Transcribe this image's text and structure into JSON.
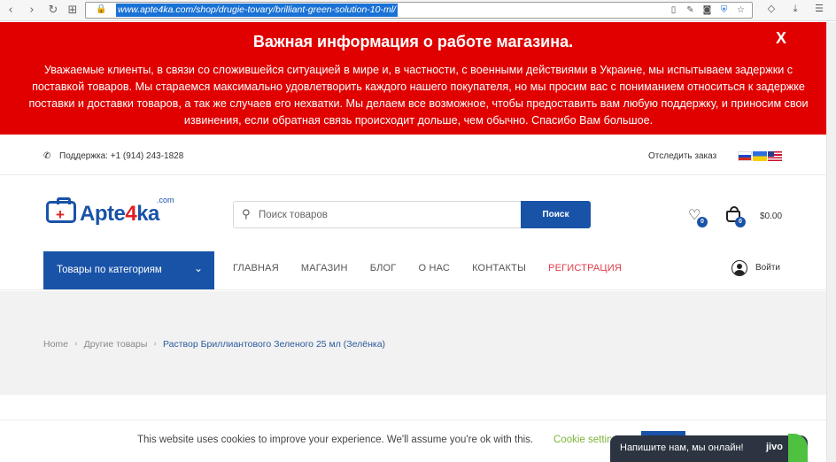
{
  "browser": {
    "url": "www.apte4ka.com/shop/drugie-tovary/brilliant-green-solution-10-ml/"
  },
  "notice": {
    "title": "Важная информация о работе магазина.",
    "close": "X",
    "body": "Уважаемые клиенты, в связи со сложившейся ситуацией в мире и, в частности, с военными действиями в Украине, мы испытываем задержки с поставкой товаров. Мы стараемся максимально удовлетворить каждого нашего покупателя, но мы просим вас с пониманием относиться к задержке поставки и доставки товаров, а так же случаев его нехватки. Мы делаем все возможное, чтобы предоставить вам любую поддержку, и приносим свои извинения, если обратная связь происходит дольше, чем обычно. Спасибо Вам большое."
  },
  "topbar": {
    "support": "Поддержка: +1 (914) 243-1828",
    "track_order": "Отследить заказ"
  },
  "header": {
    "logo_main": "Apte",
    "logo_four": "4",
    "logo_end": "ka",
    "logo_com": ".com",
    "search_placeholder": "Поиск товаров",
    "search_button": "Поиск",
    "wishlist_count": "0",
    "cart_count": "0",
    "cart_total": "$0.00"
  },
  "nav": {
    "categories": "Товары по категориям",
    "items": [
      "ГЛАВНАЯ",
      "МАГАЗИН",
      "БЛОГ",
      "О НАС",
      "КОНТАКТЫ",
      "РЕГИСТРАЦИЯ"
    ],
    "login": "Войти"
  },
  "breadcrumb": {
    "items": [
      "Home",
      "Другие товары",
      "Раствор Бриллиантового Зеленого 25 мл (Зелёнка)"
    ]
  },
  "cookie": {
    "text": "This website uses cookies to improve your experience. We'll assume you're ok with this.",
    "settings": "Cookie settings"
  },
  "chat": {
    "text": "Напишите нам, мы онлайн!",
    "brand": "jivo"
  },
  "colors": {
    "brand_blue": "#1953a8",
    "notice_red": "#e00000",
    "register_red": "#e03c4a",
    "cookie_green": "#7db43a"
  }
}
